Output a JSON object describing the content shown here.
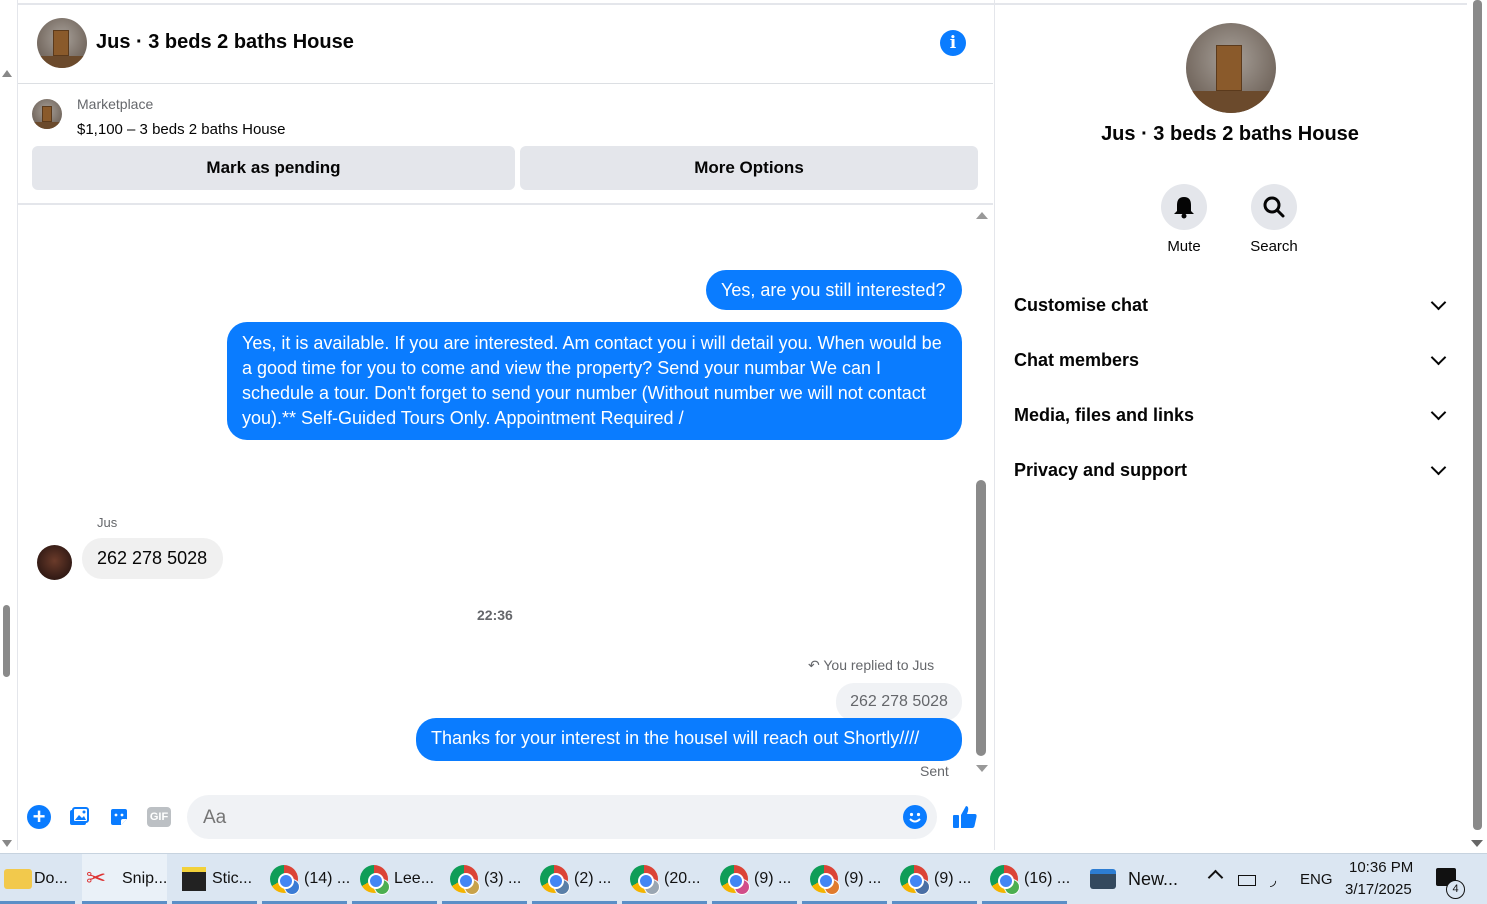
{
  "header": {
    "title": "Jus · 3 beds 2 baths House"
  },
  "marketplace": {
    "label": "Marketplace",
    "listing": "$1,100 – 3 beds 2 baths House",
    "mark_pending": "Mark as pending",
    "more_options": "More Options"
  },
  "messages": {
    "msg1": "Yes, are you still interested?",
    "msg2": "Yes, it is available. If you are interested.  Am contact you i will detail you.  When would be a good time for you to come and view the property? Send your numbar We can I schedule a tour.  Don't forget to send your number (Without number we will not contact you).** Self-Guided Tours Only. Appointment Required /",
    "sender_name": "Jus",
    "msg3": "262 278 5028",
    "timestamp": "22:36",
    "reply_note": "You replied to Jus",
    "reply_quote": "262 278 5028",
    "msg4": "Thanks for your interest in the houseI will reach out Shortly////",
    "status": "Sent"
  },
  "composer": {
    "placeholder": "Aa",
    "gif_label": "GIF"
  },
  "right_panel": {
    "title": "Jus · 3 beds 2 baths House",
    "mute_label": "Mute",
    "search_label": "Search",
    "rows": [
      "Customise chat",
      "Chat members",
      "Media, files and links",
      "Privacy and support"
    ]
  },
  "taskbar": {
    "items": [
      "Do...",
      "Snip...",
      "Stic...",
      "(14) ...",
      "Lee...",
      "(3) ...",
      "(2) ...",
      "(20...",
      "(9) ...",
      "(9) ...",
      "(9) ...",
      "(16) ...",
      "New..."
    ],
    "lang": "ENG",
    "time": "10:36 PM",
    "date": "3/17/2025",
    "notifications": "4"
  },
  "colors": {
    "accent": "#0a7cff",
    "bubble_in": "#f0f0f0",
    "taskbar": "#dbe6f2"
  }
}
